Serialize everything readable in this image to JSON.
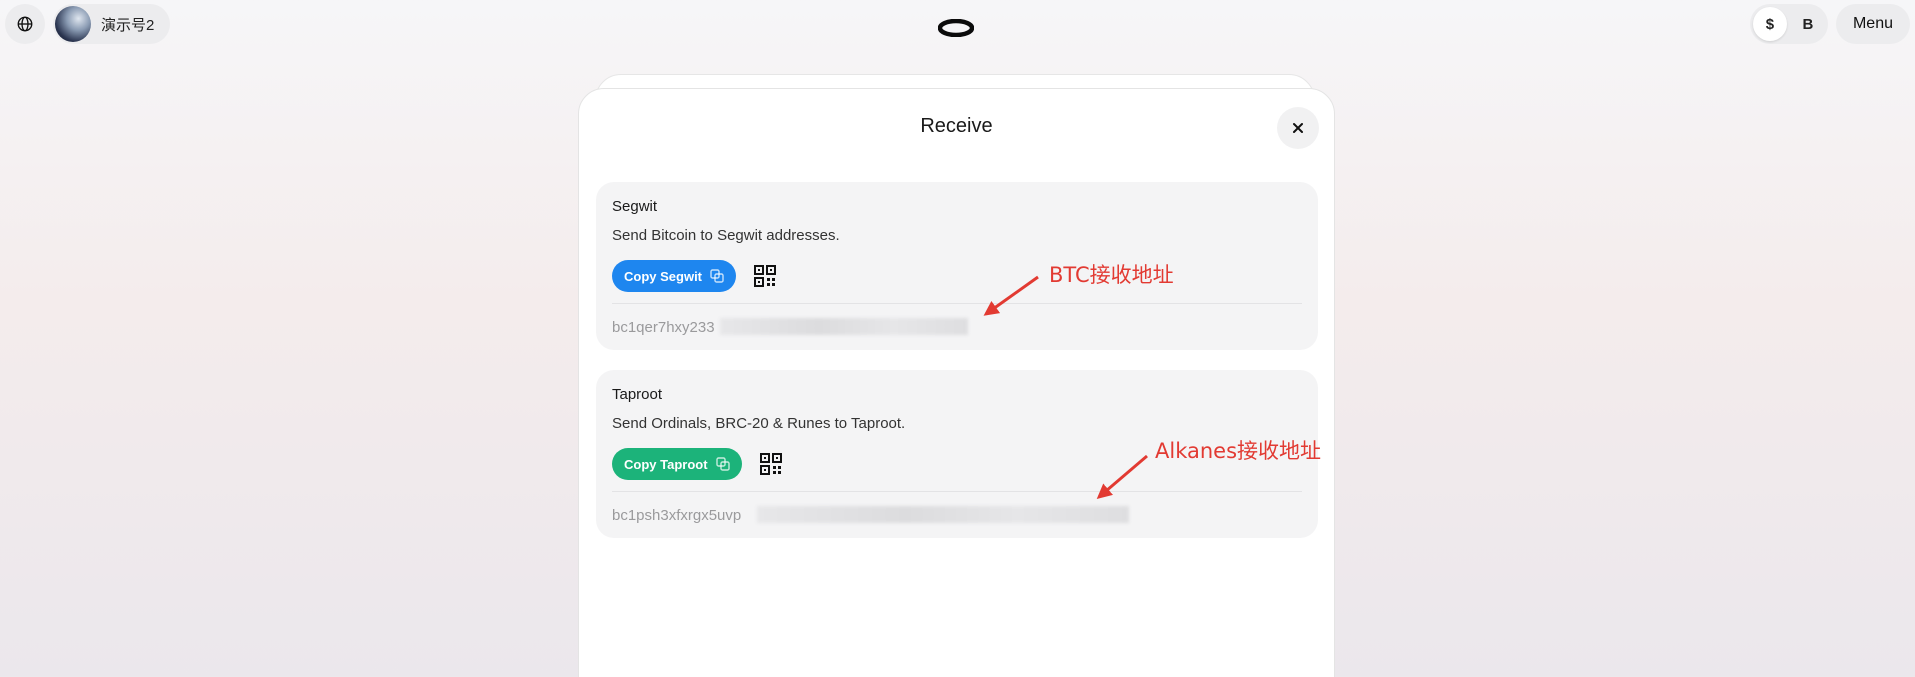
{
  "header": {
    "account_name": "演示号2",
    "currency_options": [
      "$",
      "B"
    ],
    "currency_selected": "$",
    "menu_label": "Menu"
  },
  "modal": {
    "title": "Receive",
    "segwit": {
      "title": "Segwit",
      "description": "Send Bitcoin to Segwit addresses.",
      "copy_label": "Copy Segwit",
      "address_visible": "bc1qer7hxy233"
    },
    "taproot": {
      "title": "Taproot",
      "description": "Send Ordinals, BRC-20 & Runes to Taproot.",
      "copy_label": "Copy Taproot",
      "address_visible": "bc1psh3xfxrgx5uvp"
    }
  },
  "annotations": {
    "segwit_note": "BTC接收地址",
    "taproot_note": "Alkanes接收地址"
  },
  "colors": {
    "segwit_button": "#1e86ef",
    "taproot_button": "#1cb37a",
    "annotation": "#e23a32"
  }
}
